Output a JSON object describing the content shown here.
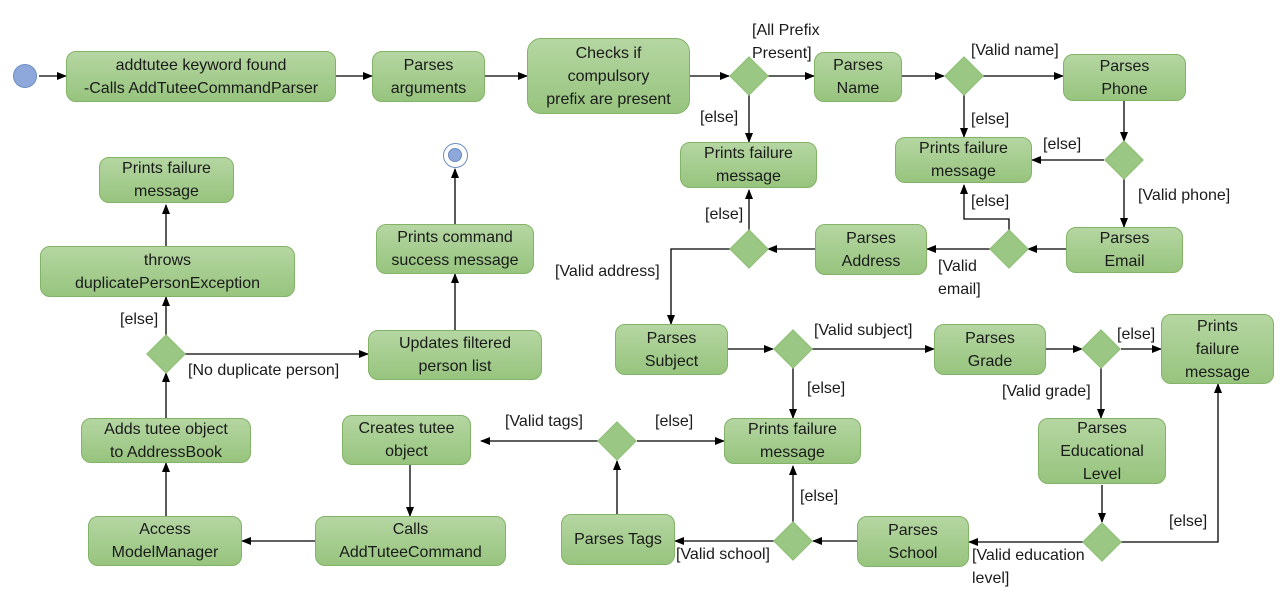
{
  "diagram_title": "",
  "nodes": {
    "n1": "addtutee keyword found\n-Calls AddTuteeCommandParser",
    "n2": "Parses\narguments",
    "n3": "Checks if\ncompulsory\nprefix are present",
    "n4": "Parses\nName",
    "n5": "Parses\nPhone",
    "n6": "Prints failure\nmessage",
    "n7": "Prints failure\nmessage",
    "n8": "Parses\nEmail",
    "n9": "Parses\nAddress",
    "n10": "Parses\nSubject",
    "n11": "Parses\nGrade",
    "n12": "Prints\nfailure\nmessage",
    "n13": "Parses\nEducational\nLevel",
    "n14": "Parses\nSchool",
    "n15": "Parses Tags",
    "n16": "Prints failure\nmessage",
    "n17": "Creates tutee\nobject",
    "n18": "Calls\nAddTuteeCommand",
    "n19": "Access\nModelManager",
    "n20": "Adds tutee object\nto AddressBook",
    "n21": "throws\nduplicatePersonException",
    "n22": "Prints failure\nmessage",
    "n23": "Updates filtered\nperson list",
    "n24": "Prints command\nsuccess message"
  },
  "guards": {
    "all_prefix": "[All Prefix\nPresent]",
    "else_prefix": "[else]",
    "valid_name": "[Valid name]",
    "else_name": "[else]",
    "else_phone": "[else]",
    "valid_phone": "[Valid phone]",
    "else_email": "[else]",
    "valid_email": "[Valid\nemail]",
    "else_address": "[else]",
    "valid_address": "[Valid address]",
    "valid_subject": "[Valid subject]",
    "else_subject": "[else]",
    "else_grade": "[else]",
    "valid_grade": "[Valid grade]",
    "else_edu": "[else]",
    "valid_edu": "[Valid education\nlevel]",
    "else_school": "[else]",
    "valid_school": "[Valid school]",
    "valid_tags": "[Valid tags]",
    "else_tags": "[else]",
    "else_duplicate": "[else]",
    "no_duplicate": "[No duplicate person]"
  },
  "colors": {
    "node_fill": "#a6cf8f",
    "node_border": "#82b366",
    "start_fill": "#8fa8dc",
    "edge": "#000000"
  }
}
